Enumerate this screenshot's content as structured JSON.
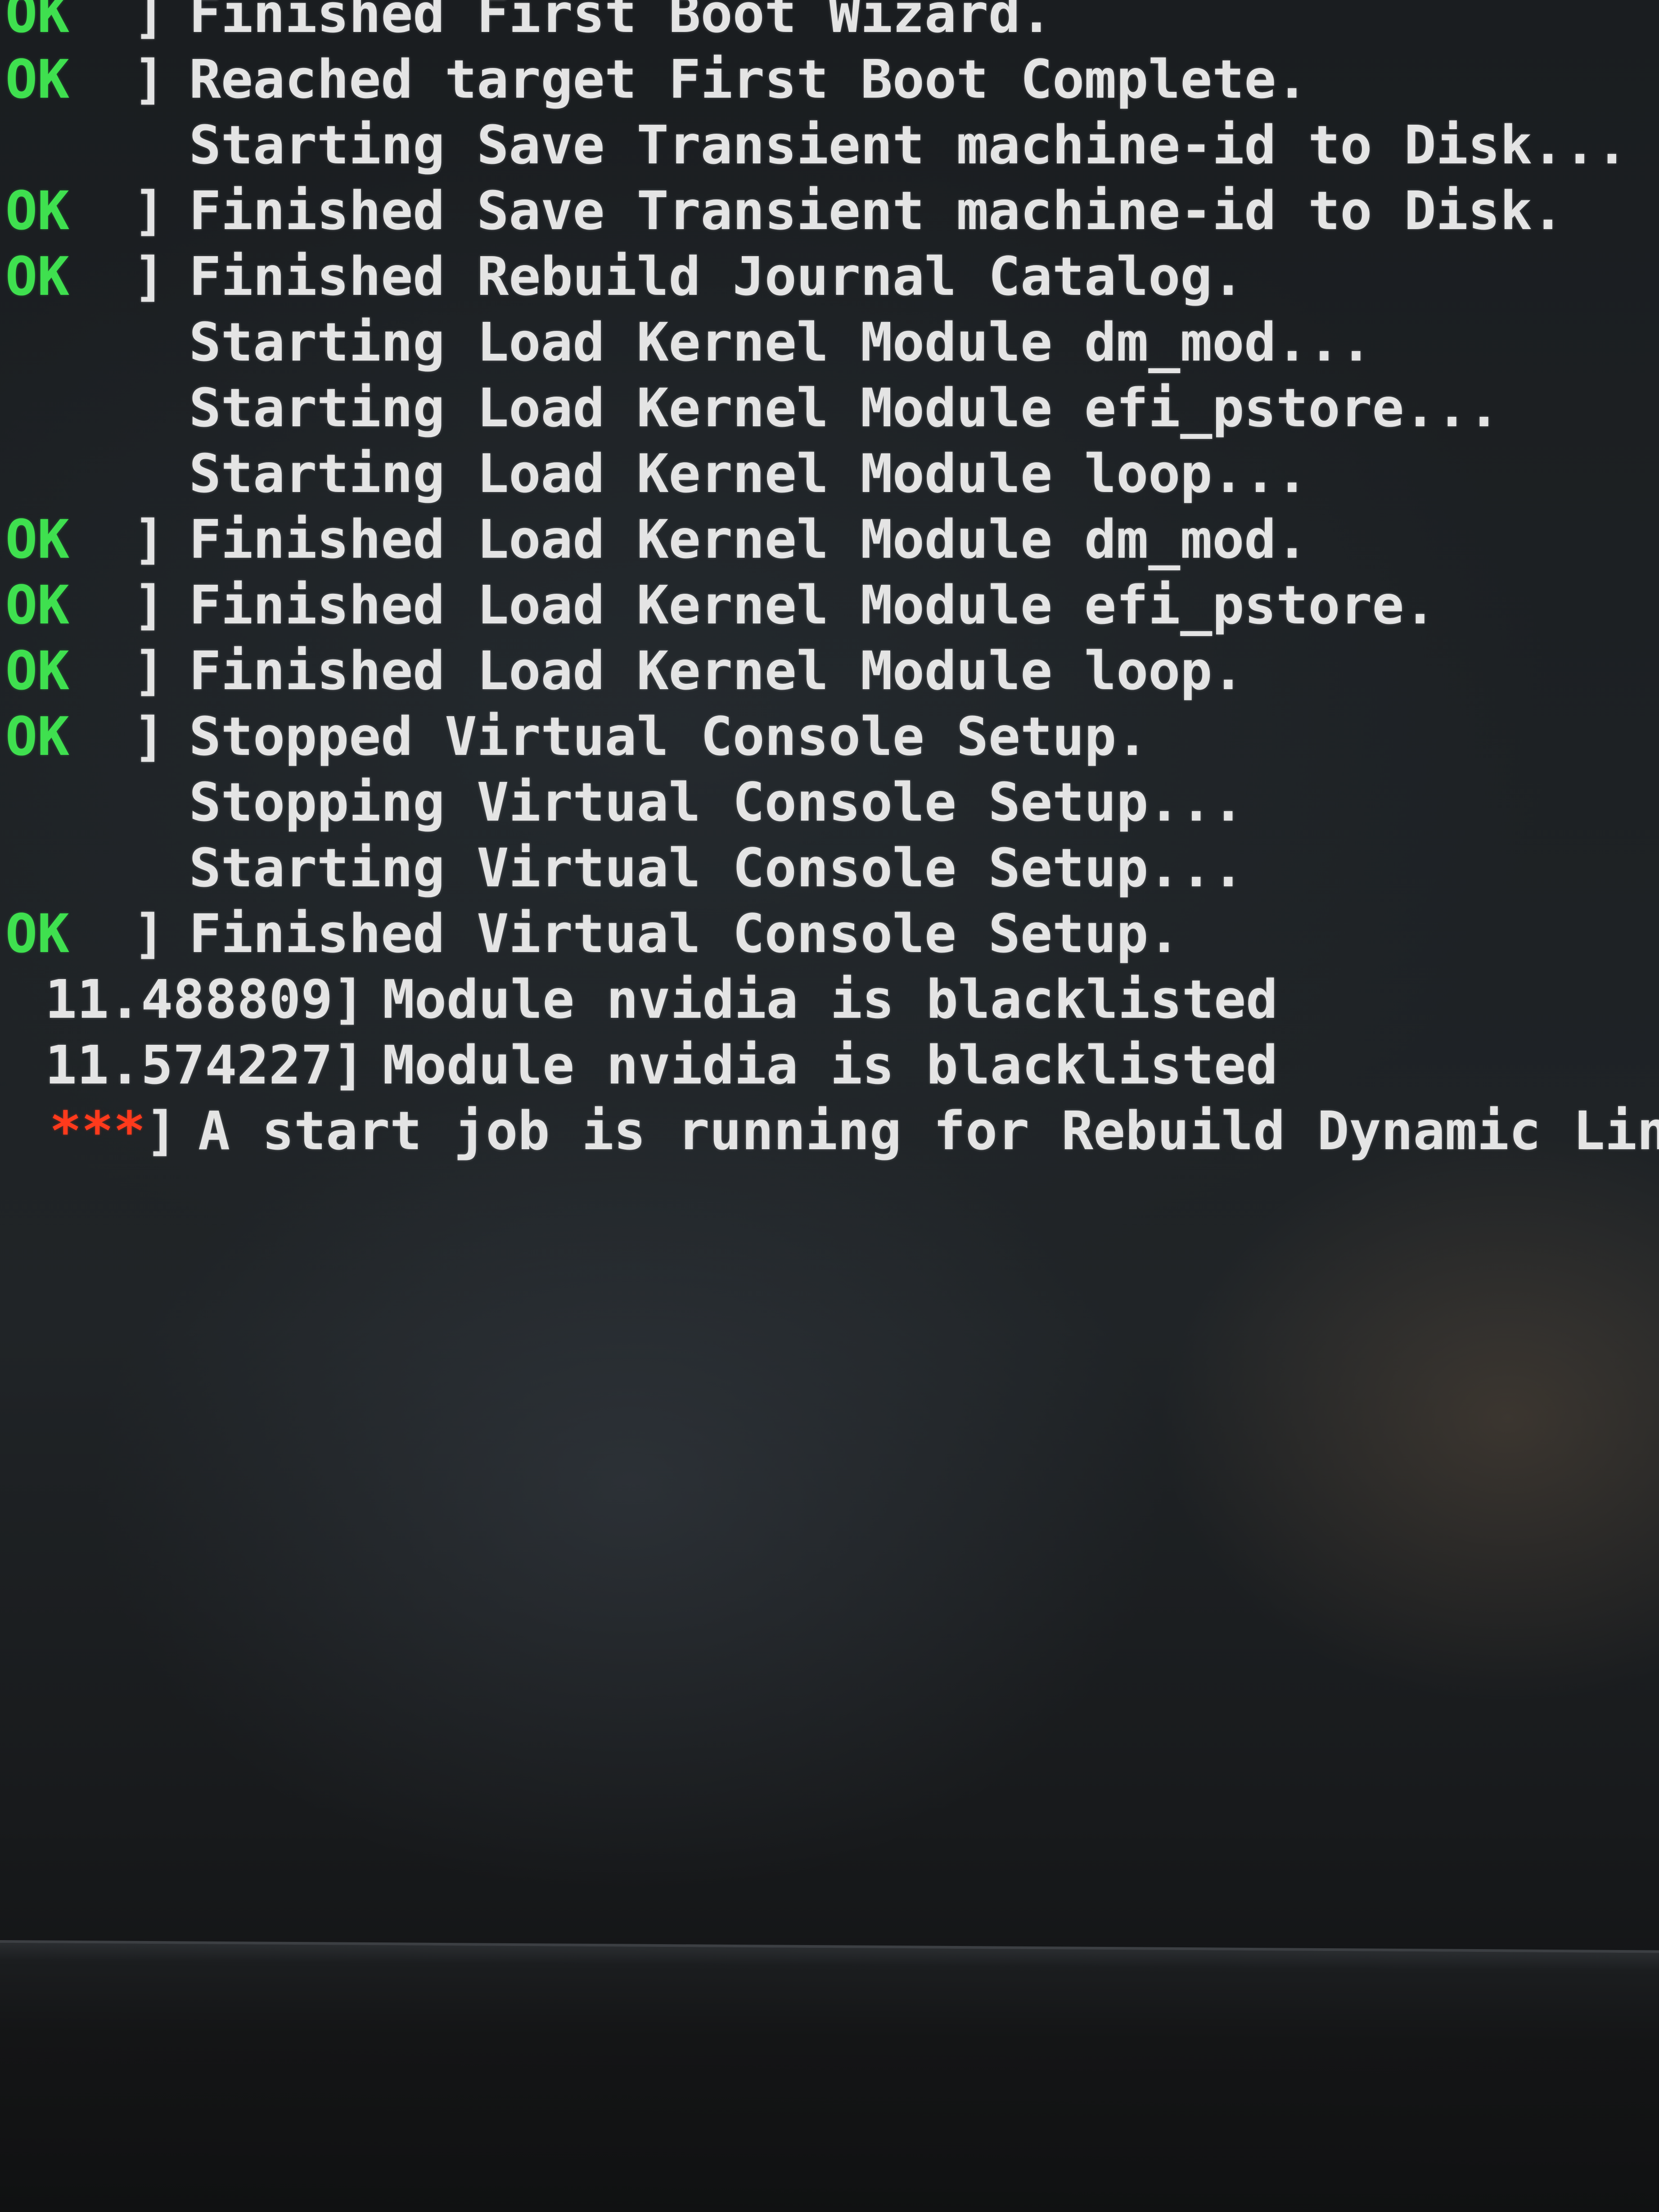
{
  "console": {
    "lines": [
      {
        "kind": "status",
        "status": "OK",
        "text": "Finished First Boot Wizard."
      },
      {
        "kind": "status",
        "status": "OK",
        "text": "Reached target First Boot Complete."
      },
      {
        "kind": "plain",
        "text": "Starting Save Transient machine-id to Disk..."
      },
      {
        "kind": "status",
        "status": "OK",
        "text": "Finished Save Transient machine-id to Disk."
      },
      {
        "kind": "status",
        "status": "OK",
        "text": "Finished Rebuild Journal Catalog."
      },
      {
        "kind": "plain",
        "text": "Starting Load Kernel Module dm_mod..."
      },
      {
        "kind": "plain",
        "text": "Starting Load Kernel Module efi_pstore..."
      },
      {
        "kind": "plain",
        "text": "Starting Load Kernel Module loop..."
      },
      {
        "kind": "status",
        "status": "OK",
        "text": "Finished Load Kernel Module dm_mod."
      },
      {
        "kind": "status",
        "status": "OK",
        "text": "Finished Load Kernel Module efi_pstore."
      },
      {
        "kind": "status",
        "status": "OK",
        "text": "Finished Load Kernel Module loop."
      },
      {
        "kind": "status",
        "status": "OK",
        "text": "Stopped Virtual Console Setup."
      },
      {
        "kind": "plain",
        "text": "Stopping Virtual Console Setup..."
      },
      {
        "kind": "plain",
        "text": "Starting Virtual Console Setup..."
      },
      {
        "kind": "status",
        "status": "OK",
        "text": "Finished Virtual Console Setup."
      },
      {
        "kind": "kernel",
        "timestamp": "11.488809]",
        "text": "Module nvidia is blacklisted"
      },
      {
        "kind": "kernel",
        "timestamp": "11.574227]",
        "text": "Module nvidia is blacklisted"
      },
      {
        "kind": "job",
        "status": "***",
        "text": "A start job is running for Rebuild Dynamic Lin"
      }
    ]
  },
  "colors": {
    "ok": "#3fe04f",
    "running": "#ff3a1c",
    "text": "#e4e4e4",
    "background": "#1c1f22"
  }
}
